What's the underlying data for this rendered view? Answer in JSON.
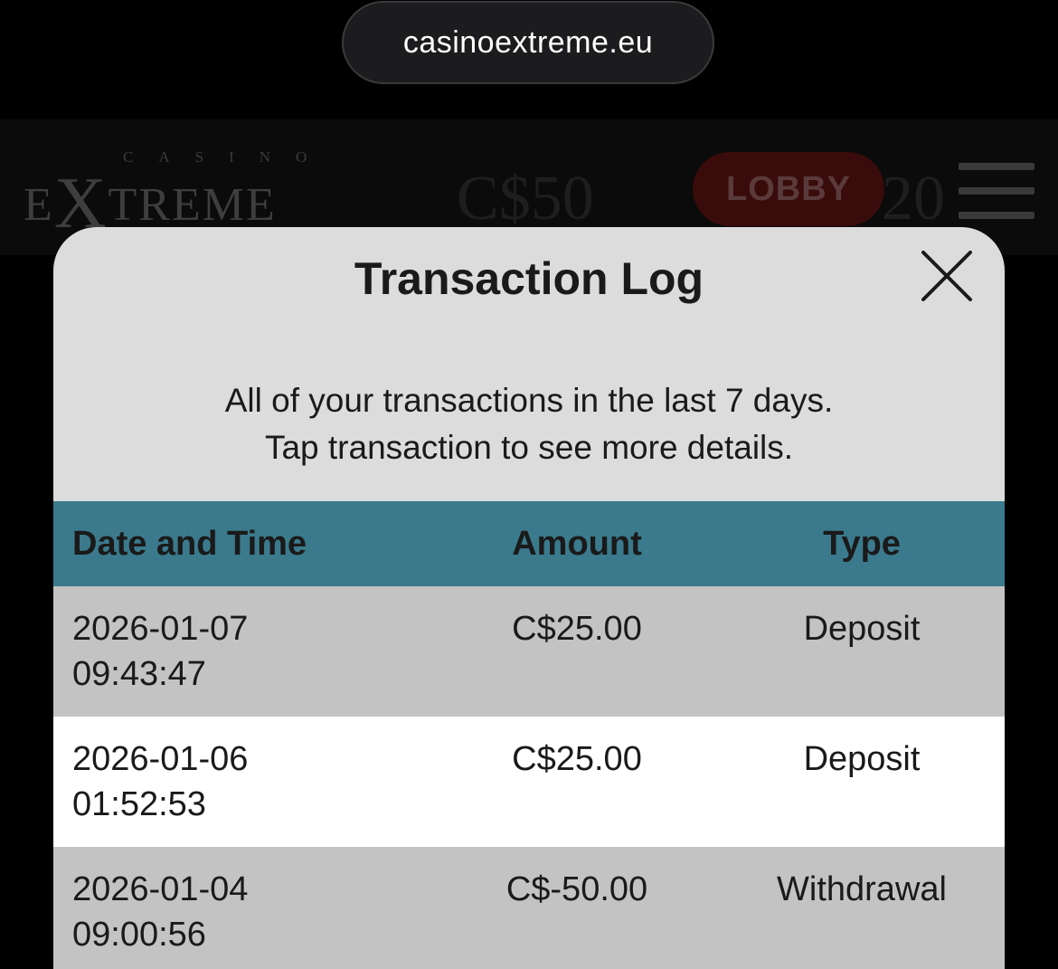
{
  "browser": {
    "url": "casinoextreme.eu"
  },
  "site_header": {
    "logo_small": "CASINO",
    "logo_main_x": "X",
    "logo_main_prefix": "E",
    "logo_main_suffix": "TREME",
    "balance": "C$50",
    "lobby_label": "LOBBY",
    "bonus_value": "20"
  },
  "modal": {
    "title": "Transaction Log",
    "description_line1": "All of your transactions in the last 7 days.",
    "description_line2": "Tap transaction to see more details.",
    "columns": {
      "date": "Date and Time",
      "amount": "Amount",
      "type": "Type"
    },
    "rows": [
      {
        "date": "2026-01-07",
        "time": "09:43:47",
        "amount": "C$25.00",
        "type": "Deposit"
      },
      {
        "date": "2026-01-06",
        "time": "01:52:53",
        "amount": "C$25.00",
        "type": "Deposit"
      },
      {
        "date": "2026-01-04",
        "time": "09:00:56",
        "amount": "C$-50.00",
        "type": "Withdrawal"
      }
    ]
  },
  "colors": {
    "table_header": "#3a7a8c",
    "modal_bg": "#dcdcdc",
    "row_grey": "#c3c3c3",
    "row_white": "#ffffff"
  }
}
